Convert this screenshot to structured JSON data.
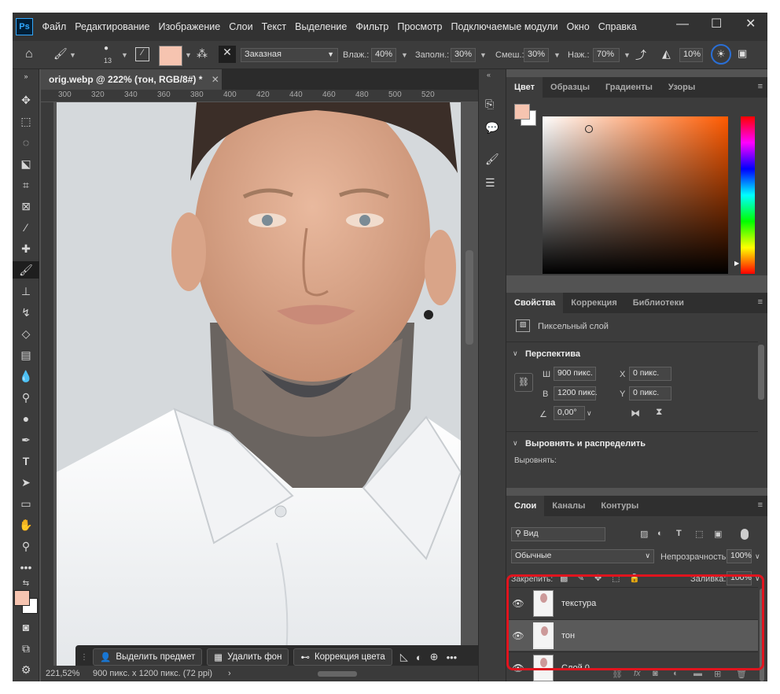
{
  "app": {
    "logo": "Ps"
  },
  "menu": [
    "Файл",
    "Редактирование",
    "Изображение",
    "Слои",
    "Текст",
    "Выделение",
    "Фильтр",
    "Просмотр",
    "Подключаемые модули",
    "Окно",
    "Справка"
  ],
  "options": {
    "brush_size": "13",
    "mode": "Заказная",
    "wet_label": "Влаж.:",
    "wet_value": "40%",
    "load_label": "Заполн.:",
    "load_value": "30%",
    "mix_label": "Смеш.:",
    "mix_value": "30%",
    "flow_label": "Наж.:",
    "flow_value": "70%",
    "angle_value": "10%"
  },
  "document": {
    "tab_title": "orig.webp @ 222% (тон, RGB/8#) *",
    "ruler_ticks": [
      "300",
      "320",
      "340",
      "360",
      "380",
      "400",
      "420",
      "440",
      "460",
      "480",
      "500",
      "520"
    ],
    "zoom": "221,52%",
    "doc_info": "900 пикс. x 1200 пикс. (72 ppi)"
  },
  "context_bar": {
    "select_subject": "Выделить предмет",
    "remove_bg": "Удалить фон",
    "color_correction": "Коррекция цвета"
  },
  "color_panel": {
    "tabs": [
      "Цвет",
      "Образцы",
      "Градиенты",
      "Узоры"
    ],
    "fg_color": "#f6c4b0",
    "bg_color": "#ffffff"
  },
  "properties_panel": {
    "tabs": [
      "Свойства",
      "Коррекция",
      "Библиотеки"
    ],
    "layer_kind": "Пиксельный слой",
    "transform_section": "Перспектива",
    "w_label": "Ш",
    "w_value": "900 пикс.",
    "h_label": "В",
    "h_value": "1200 пикс.",
    "x_label": "X",
    "x_value": "0 пикс.",
    "y_label": "Y",
    "y_value": "0 пикс.",
    "angle_value": "0,00°",
    "align_section": "Выровнять и распределить",
    "align_label": "Выровнять:"
  },
  "layers_panel": {
    "tabs": [
      "Слои",
      "Каналы",
      "Контуры"
    ],
    "filter_kind": "Вид",
    "blend_mode": "Обычные",
    "opacity_label": "Непрозрачность:",
    "opacity_value": "100%",
    "lock_label": "Закрепить:",
    "fill_label": "Заливка:",
    "fill_value": "100%",
    "layers": [
      {
        "name": "текстура",
        "selected": false
      },
      {
        "name": "тон",
        "selected": true
      },
      {
        "name": "Слой 0",
        "selected": false
      }
    ],
    "highlight_color": "#e0141e"
  }
}
